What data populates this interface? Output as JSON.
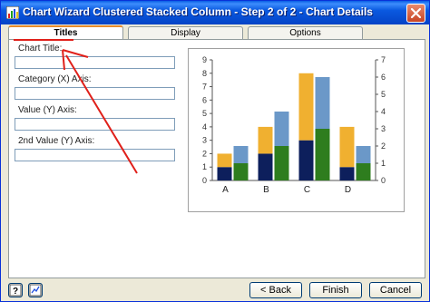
{
  "window": {
    "title": "Chart Wizard Clustered Stacked Column - Step 2 of 2 - Chart Details"
  },
  "tabs": [
    {
      "label": "Titles",
      "active": true
    },
    {
      "label": "Display",
      "active": false
    },
    {
      "label": "Options",
      "active": false
    }
  ],
  "fields": {
    "chart_title": {
      "label": "Chart Title:",
      "value": ""
    },
    "category_axis": {
      "label": "Category (X) Axis:",
      "value": ""
    },
    "value_axis": {
      "label": "Value (Y) Axis:",
      "value": ""
    },
    "second_value_axis": {
      "label": "2nd Value (Y) Axis:",
      "value": ""
    }
  },
  "chart_data": {
    "type": "bar",
    "categories": [
      "A",
      "B",
      "C",
      "D"
    ],
    "primary_axis": {
      "ylim": [
        0,
        9
      ],
      "ticks": [
        "0",
        "1",
        "2",
        "3",
        "4",
        "5",
        "6",
        "7",
        "8",
        "9"
      ]
    },
    "secondary_axis": {
      "ylim": [
        0,
        7
      ],
      "ticks": [
        "0",
        "1",
        "2",
        "3",
        "4",
        "5",
        "6",
        "7"
      ]
    },
    "clusters": [
      {
        "stack": [
          1,
          1
        ],
        "colors": [
          "#0d1f5c",
          "#f0b030"
        ]
      },
      {
        "stack": [
          1,
          1
        ],
        "colors": [
          "#2e7d1e",
          "#6b98c8"
        ]
      }
    ],
    "series_primary": {
      "bottom": [
        1,
        2,
        3,
        1
      ],
      "top": [
        1,
        2,
        5,
        3
      ]
    },
    "series_secondary": {
      "bottom": [
        1,
        2,
        3,
        1
      ],
      "top": [
        1,
        2,
        3,
        1
      ]
    },
    "colors": {
      "primary_bottom": "#0d1f5c",
      "primary_top": "#f0b030",
      "secondary_bottom": "#2e7d1e",
      "secondary_top": "#6b98c8",
      "annotation": "#e0201a"
    }
  },
  "buttons": {
    "back": "< Back",
    "finish": "Finish",
    "cancel": "Cancel"
  }
}
